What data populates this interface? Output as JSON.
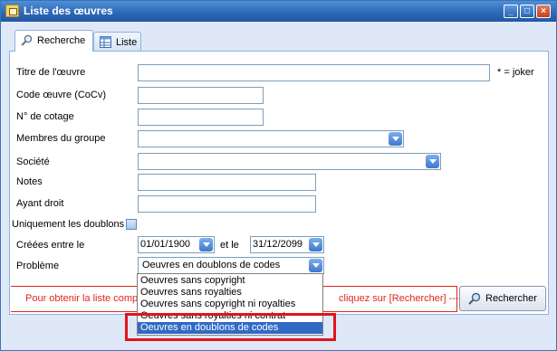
{
  "window": {
    "title": "Liste des œuvres"
  },
  "tabs": [
    {
      "label": "Recherche"
    },
    {
      "label": "Liste"
    }
  ],
  "form": {
    "titre_label": "Titre de l'œuvre",
    "joker_note": "* = joker",
    "code_label": "Code œuvre (CoCv)",
    "cotage_label": "N° de cotage",
    "membres_label": "Membres du groupe",
    "societe_label": "Société",
    "notes_label": "Notes",
    "ayant_label": "Ayant droit",
    "doublons_label": "Uniquement les doublons",
    "creees_label": "Créées entre le",
    "date_from": "01/01/1900",
    "et_le": "et le",
    "date_to": "31/12/2099",
    "probleme_label": "Problème",
    "probleme_value": "Oeuvres en doublons de codes"
  },
  "dropdown": {
    "options": [
      "Oeuvres sans copyright",
      "Oeuvres sans royalties",
      "Oeuvres sans copyright ni royalties",
      "Oeuvres sans royalties ni contrat",
      "Oeuvres en doublons de codes"
    ],
    "selected_index": 4
  },
  "footer": {
    "hint_left": "Pour obtenir la liste compl",
    "hint_right": "cliquez sur [Rechercher] --->",
    "search_button": "Rechercher"
  },
  "colors": {
    "title_bar": "#2d69b8",
    "hint_red": "#e1261c",
    "highlight": "#e0141e"
  }
}
